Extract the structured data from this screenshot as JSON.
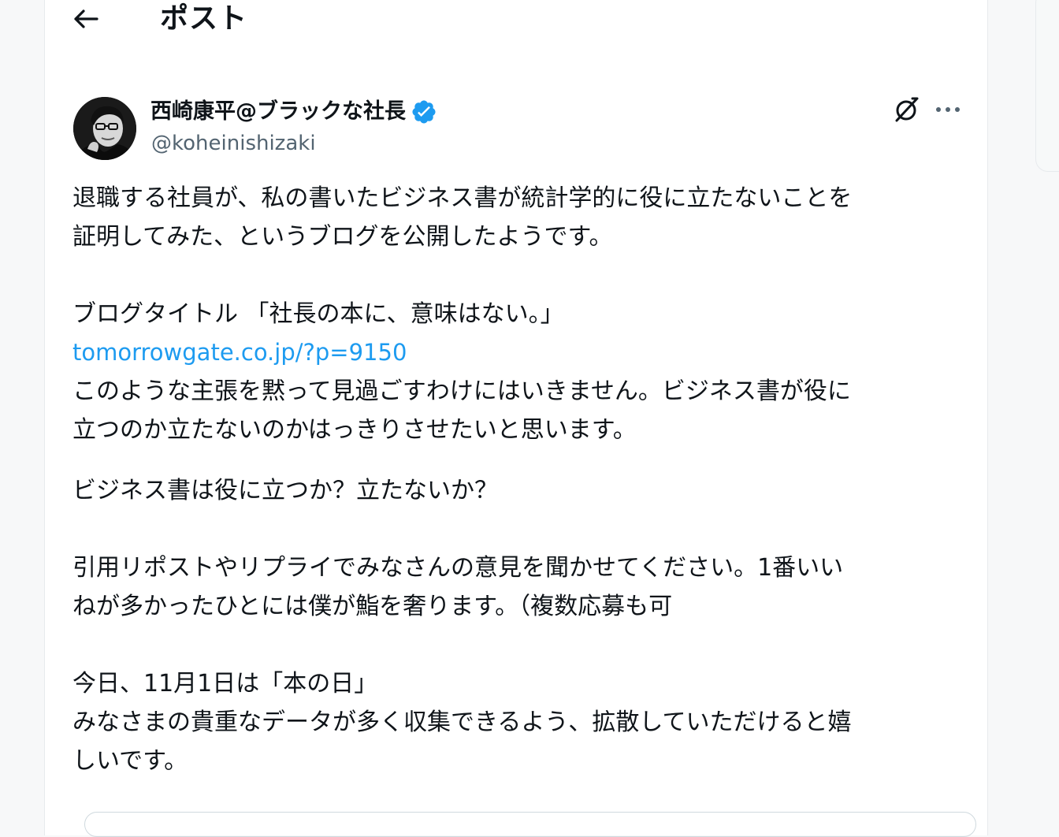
{
  "header": {
    "back_icon": "arrow-left-icon",
    "title": "ポスト"
  },
  "author": {
    "name": "西崎康平@ブラックな社長",
    "handle": "@koheinishizaki",
    "verified_icon": "verified-badge-icon",
    "verified_color": "#1d9bf0"
  },
  "actions": {
    "grok_icon": "grok-icon",
    "more_icon": "more-horizontal-icon"
  },
  "tweet": {
    "line1": "退職する社員が、私の書いたビジネス書が統計学的に役に立たないことを",
    "line2": "証明してみた、というブログを公開したようです。",
    "line3": "ブログタイトル 「社長の本に、意味はない。」",
    "link": "tomorrowgate.co.jp/?p=9150",
    "line4": "このような主張を黙って見過ごすわけにはいきません。ビジネス書が役に",
    "line5": "立つのか立たないのかはっきりさせたいと思います。",
    "line6": "ビジネス書は役に立つか？立たないか？",
    "line7": "引用リポストやリプライでみなさんの意見を聞かせてください。1番いい",
    "line8": "ねが多かったひとには僕が鮨を奢ります。（複数応募も可",
    "line9": "今日、11月1日は「本の日」",
    "line10": "みなさまの貴重なデータが多く収集できるよう、拡散していただけると嬉",
    "line11": "しいです。"
  },
  "colors": {
    "link": "#1d9bf0",
    "text": "#0f1419",
    "secondary": "#536471"
  }
}
